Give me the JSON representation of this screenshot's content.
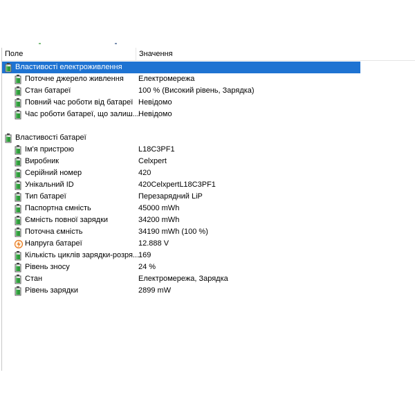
{
  "columns": {
    "field": "Поле",
    "value": "Значення"
  },
  "colors": {
    "selection": "#1e73d2",
    "battery_green": "#2e9a3a",
    "voltage_orange": "#e8741a"
  },
  "groups": [
    {
      "title": "Властивості електроживлення",
      "icon": "battery-icon",
      "selected": true,
      "items": [
        {
          "name": "Поточне джерело живлення",
          "value": "Електромережа",
          "icon": "battery-icon"
        },
        {
          "name": "Стан батареї",
          "value": "100 % (Високий рівень, Зарядка)",
          "icon": "battery-icon"
        },
        {
          "name": "Повний час роботи від батареї",
          "value": "Невідомо",
          "icon": "battery-icon"
        },
        {
          "name": "Час роботи батареї, що залиш...",
          "value": "Невідомо",
          "icon": "battery-icon"
        }
      ]
    },
    {
      "title": "Властивості батареї",
      "icon": "battery-icon",
      "selected": false,
      "items": [
        {
          "name": "Ім'я пристрою",
          "value": "L18C3PF1",
          "icon": "battery-icon"
        },
        {
          "name": "Виробник",
          "value": "Celxpert",
          "icon": "battery-icon"
        },
        {
          "name": "Серійний номер",
          "value": "420",
          "icon": "battery-icon"
        },
        {
          "name": "Унікальний ID",
          "value": "420CelxpertL18C3PF1",
          "icon": "battery-icon"
        },
        {
          "name": "Тип батареї",
          "value": "Перезарядний LiP",
          "icon": "battery-icon"
        },
        {
          "name": "Паспортна ємність",
          "value": "45000 mWh",
          "icon": "battery-icon"
        },
        {
          "name": "Ємність повної зарядки",
          "value": "34200 mWh",
          "icon": "battery-icon"
        },
        {
          "name": "Поточна ємність",
          "value": "34190 mWh  (100 %)",
          "icon": "battery-icon"
        },
        {
          "name": "Напруга батареї",
          "value": "12.888 V",
          "icon": "voltage-icon"
        },
        {
          "name": "Кількість циклів зарядки-розря...",
          "value": "169",
          "icon": "battery-icon"
        },
        {
          "name": "Рівень зносу",
          "value": "24 %",
          "icon": "battery-icon"
        },
        {
          "name": "Стан",
          "value": "Електромережа, Зарядка",
          "icon": "battery-icon"
        },
        {
          "name": "Рівень зарядки",
          "value": "2899 mW",
          "icon": "battery-icon"
        }
      ]
    }
  ]
}
